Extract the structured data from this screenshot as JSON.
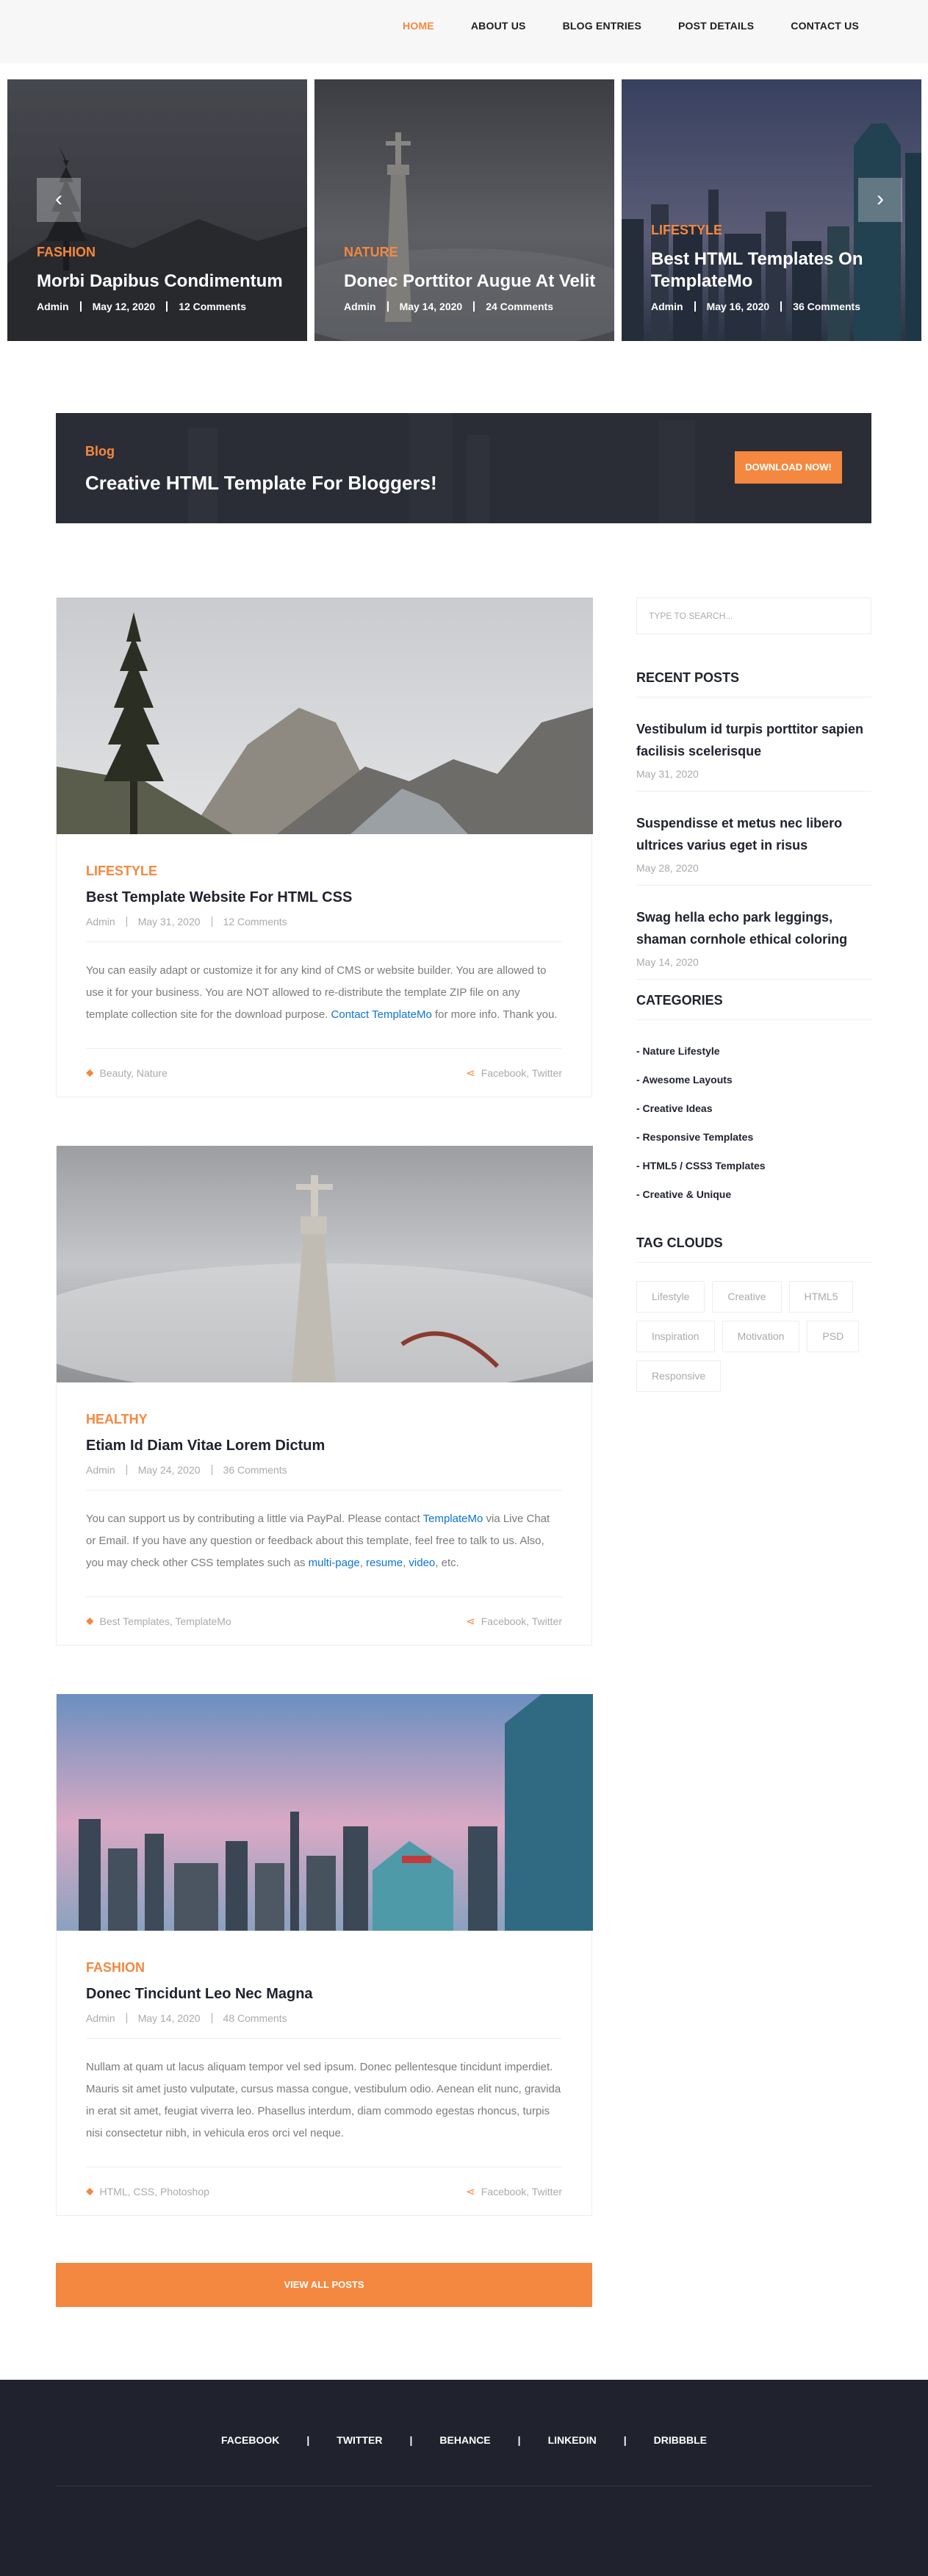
{
  "nav": {
    "items": [
      "HOME",
      "ABOUT US",
      "BLOG ENTRIES",
      "POST DETAILS",
      "CONTACT US"
    ],
    "active": "HOME"
  },
  "slider": {
    "prev_icon": "chevron-left-icon",
    "next_icon": "chevron-right-icon",
    "prev_glyph": "‹",
    "next_glyph": "›",
    "slides": [
      {
        "category": "Fashion",
        "title": "Morbi Dapibus Condimentum",
        "author": "Admin",
        "date": "May 12, 2020",
        "comments": "12 Comments"
      },
      {
        "category": "Nature",
        "title": "Donec Porttitor Augue At Velit",
        "author": "Admin",
        "date": "May 14, 2020",
        "comments": "24 Comments"
      },
      {
        "category": "Lifestyle",
        "title": "Best HTML Templates On TemplateMo",
        "author": "Admin",
        "date": "May 16, 2020",
        "comments": "36 Comments"
      }
    ]
  },
  "cta": {
    "label": "Blog",
    "title": "Creative HTML Template For Bloggers!",
    "button": "DOWNLOAD NOW!"
  },
  "posts": [
    {
      "category": "Lifestyle",
      "title": "Best Template Website For HTML CSS",
      "author": "Admin",
      "date": "May 31, 2020",
      "comments": "12 Comments",
      "text_before": "You can easily adapt or customize it for any kind of CMS or website builder. You are allowed to use it for your business. You are NOT allowed to re-distribute the template ZIP file on any template collection site for the download purpose. ",
      "link": "Contact TemplateMo",
      "text_after": " for more info. Thank you.",
      "tags": "Beauty, Nature",
      "share": "Facebook, Twitter"
    },
    {
      "category": "Healthy",
      "title": "Etiam Id Diam Vitae Lorem Dictum",
      "author": "Admin",
      "date": "May 24, 2020",
      "comments": "36 Comments",
      "text_1": "You can support us by contributing a little via PayPal. Please contact ",
      "link_1": "TemplateMo",
      "text_2": " via Live Chat or Email. If you have any question or feedback about this template, feel free to talk to us. Also, you may check other CSS templates such as ",
      "link_2": "multi-page",
      "text_3": ", ",
      "link_3": "resume",
      "text_4": ", ",
      "link_4": "video",
      "text_5": ", etc.",
      "tags": "Best Templates, TemplateMo",
      "share": "Facebook, Twitter"
    },
    {
      "category": "Fashion",
      "title": "Donec Tincidunt Leo Nec Magna",
      "author": "Admin",
      "date": "May 14, 2020",
      "comments": "48 Comments",
      "text": "Nullam at quam ut lacus aliquam tempor vel sed ipsum. Donec pellentesque tincidunt imperdiet. Mauris sit amet justo vulputate, cursus massa congue, vestibulum odio. Aenean elit nunc, gravida in erat sit amet, feugiat viverra leo. Phasellus interdum, diam commodo egestas rhoncus, turpis nisi consectetur nibh, in vehicula eros orci vel neque.",
      "tags": "HTML, CSS, Photoshop",
      "share": "Facebook, Twitter"
    }
  ],
  "view_all": "VIEW ALL POSTS",
  "sidebar": {
    "search_placeholder": "TYPE TO SEARCH...",
    "recent_title": "Recent Posts",
    "recent": [
      {
        "title": "Vestibulum id turpis porttitor sapien facilisis scelerisque",
        "date": "May 31, 2020"
      },
      {
        "title": "Suspendisse et metus nec libero ultrices varius eget in risus",
        "date": "May 28, 2020"
      },
      {
        "title": "Swag hella echo park leggings, shaman cornhole ethical coloring",
        "date": "May 14, 2020"
      }
    ],
    "categories_title": "Categories",
    "categories": [
      "- Nature Lifestyle",
      "- Awesome Layouts",
      "- Creative Ideas",
      "- Responsive Templates",
      "- HTML5 / CSS3 Templates",
      "- Creative & Unique"
    ],
    "tags_title": "Tag Clouds",
    "tags": [
      "Lifestyle",
      "Creative",
      "HTML5",
      "Inspiration",
      "Motivation",
      "PSD",
      "Responsive"
    ]
  },
  "footer": {
    "social": [
      "FACEBOOK",
      "TWITTER",
      "BEHANCE",
      "LINKEDIN",
      "DRIBBBLE"
    ],
    "separator": "|"
  },
  "icons": {
    "tag": "tag-icon",
    "share": "share-icon",
    "tag_glyph": "⬥",
    "share_glyph": "⋖"
  },
  "colors": {
    "accent": "#f48840",
    "dark": "#20232e",
    "banner": "#2b2d36",
    "link": "#0b73d8",
    "muted": "#aaaaaa"
  }
}
